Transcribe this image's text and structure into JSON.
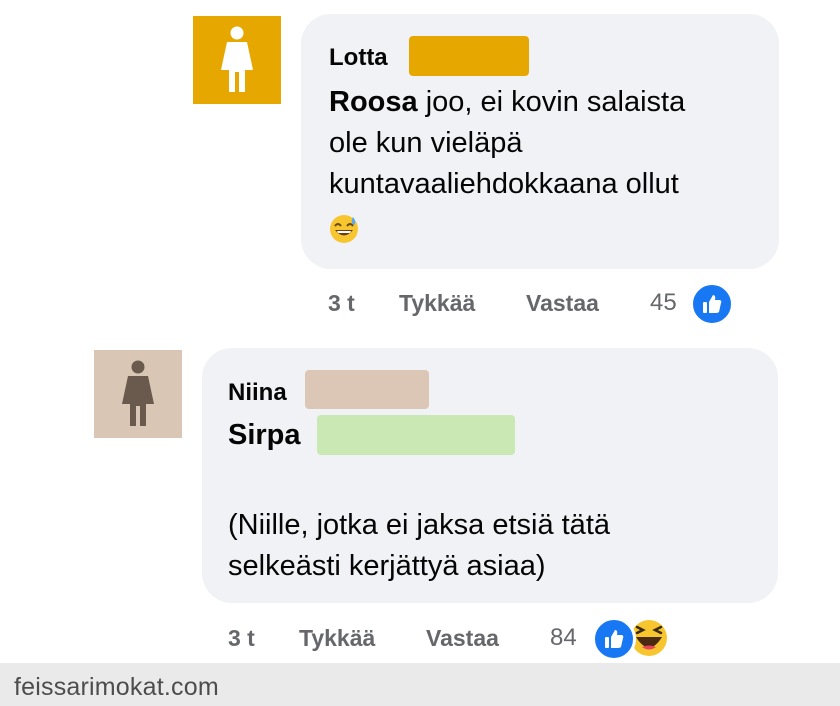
{
  "comments": [
    {
      "author": "Lotta",
      "mention": "Roosa",
      "text_lines": [
        "joo, ei kovin salaista",
        "ole kun vieläpä",
        "kuntavaaliehdokkaana ollut"
      ],
      "emoji": "grinning-sweat-emoji",
      "avatar_icon": "woman-figure-icon",
      "avatar_color": "#e6a800",
      "redaction_color": "#e6a800",
      "time": "3 t",
      "like_label": "Tykkää",
      "reply_label": "Vastaa",
      "reaction_count": "45",
      "reactions": [
        "like-icon"
      ]
    },
    {
      "author": "Niina",
      "mention": "Sirpa",
      "text_lines": [
        "(Niille, jotka ei jaksa etsiä tätä",
        "selkeästi kerjättyä asiaa)"
      ],
      "avatar_icon": "woman-figure-icon",
      "avatar_color": "#d9c6b5",
      "redaction_color": "#dcc7b6",
      "mention_redaction_color": "#c9e8b4",
      "time": "3 t",
      "like_label": "Tykkää",
      "reply_label": "Vastaa",
      "reaction_count": "84",
      "reactions": [
        "like-icon",
        "haha-icon"
      ]
    }
  ],
  "watermark": "feissarimokat.com"
}
